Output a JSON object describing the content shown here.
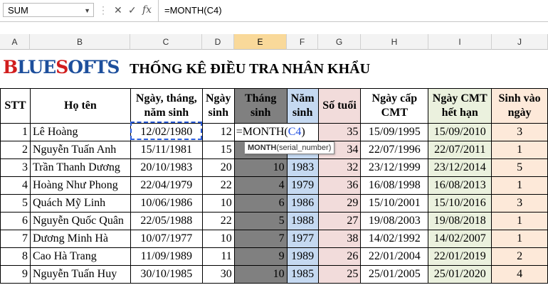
{
  "formula_bar": {
    "name_box": "SUM",
    "formula": "=MONTH(C4)"
  },
  "columns": [
    "A",
    "B",
    "C",
    "D",
    "E",
    "F",
    "G",
    "H",
    "I",
    "J"
  ],
  "selected_column": "E",
  "logo": {
    "part1": "BLUE",
    "part2": "SOFTS",
    "display": "BLUESOFTS"
  },
  "title": "THỐNG KÊ ĐIỀU TRA NHÂN KHẨU",
  "headers": {
    "stt": "STT",
    "name": "Họ tên",
    "dob": "Ngày, tháng, năm sinh",
    "day": "Ngày sinh",
    "month": "Tháng sinh",
    "year": "Năm sinh",
    "age": "Số tuổi",
    "issued": "Ngày cấp CMT",
    "expiry": "Ngày CMT hết hạn",
    "weekday": "Sinh vào ngày"
  },
  "editing_cell": {
    "prefix": "=MONTH(",
    "ref": "C4",
    "suffix": ")"
  },
  "tooltip": {
    "fn": "MONTH",
    "args": "(serial_number)"
  },
  "rows": [
    {
      "stt": "1",
      "name": "Lê Hoàng",
      "dob": "12/02/1980",
      "day": "12",
      "month": "",
      "year": "",
      "age": "35",
      "issued": "15/09/1995",
      "expiry": "15/09/2010",
      "weekday": "3"
    },
    {
      "stt": "2",
      "name": "Nguyễn Tuấn Anh",
      "dob": "15/11/1981",
      "day": "15",
      "month": "",
      "year": "",
      "age": "34",
      "issued": "22/07/1996",
      "expiry": "22/07/2011",
      "weekday": "1"
    },
    {
      "stt": "3",
      "name": "Trần Thanh Dương",
      "dob": "20/10/1983",
      "day": "20",
      "month": "10",
      "year": "1983",
      "age": "32",
      "issued": "23/12/1999",
      "expiry": "23/12/2014",
      "weekday": "5"
    },
    {
      "stt": "4",
      "name": "Hoàng Như Phong",
      "dob": "22/04/1979",
      "day": "22",
      "month": "4",
      "year": "1979",
      "age": "36",
      "issued": "16/08/1998",
      "expiry": "16/08/2013",
      "weekday": "1"
    },
    {
      "stt": "5",
      "name": "Quách Mỹ Linh",
      "dob": "10/06/1986",
      "day": "10",
      "month": "6",
      "year": "1986",
      "age": "29",
      "issued": "15/10/2001",
      "expiry": "15/10/2016",
      "weekday": "3"
    },
    {
      "stt": "6",
      "name": "Nguyễn Quốc Quân",
      "dob": "22/05/1988",
      "day": "22",
      "month": "5",
      "year": "1988",
      "age": "27",
      "issued": "19/08/2003",
      "expiry": "19/08/2018",
      "weekday": "1"
    },
    {
      "stt": "7",
      "name": "Dương Minh Hà",
      "dob": "10/07/1977",
      "day": "10",
      "month": "7",
      "year": "1977",
      "age": "38",
      "issued": "14/02/1992",
      "expiry": "14/02/2007",
      "weekday": "1"
    },
    {
      "stt": "8",
      "name": "Cao Hà Trang",
      "dob": "11/09/1989",
      "day": "11",
      "month": "9",
      "year": "1989",
      "age": "26",
      "issued": "22/01/2004",
      "expiry": "22/01/2019",
      "weekday": "2"
    },
    {
      "stt": "9",
      "name": "Nguyễn Tuấn Huy",
      "dob": "30/10/1985",
      "day": "30",
      "month": "10",
      "year": "1985",
      "age": "25",
      "issued": "25/01/2005",
      "expiry": "25/01/2020",
      "weekday": "4"
    }
  ]
}
